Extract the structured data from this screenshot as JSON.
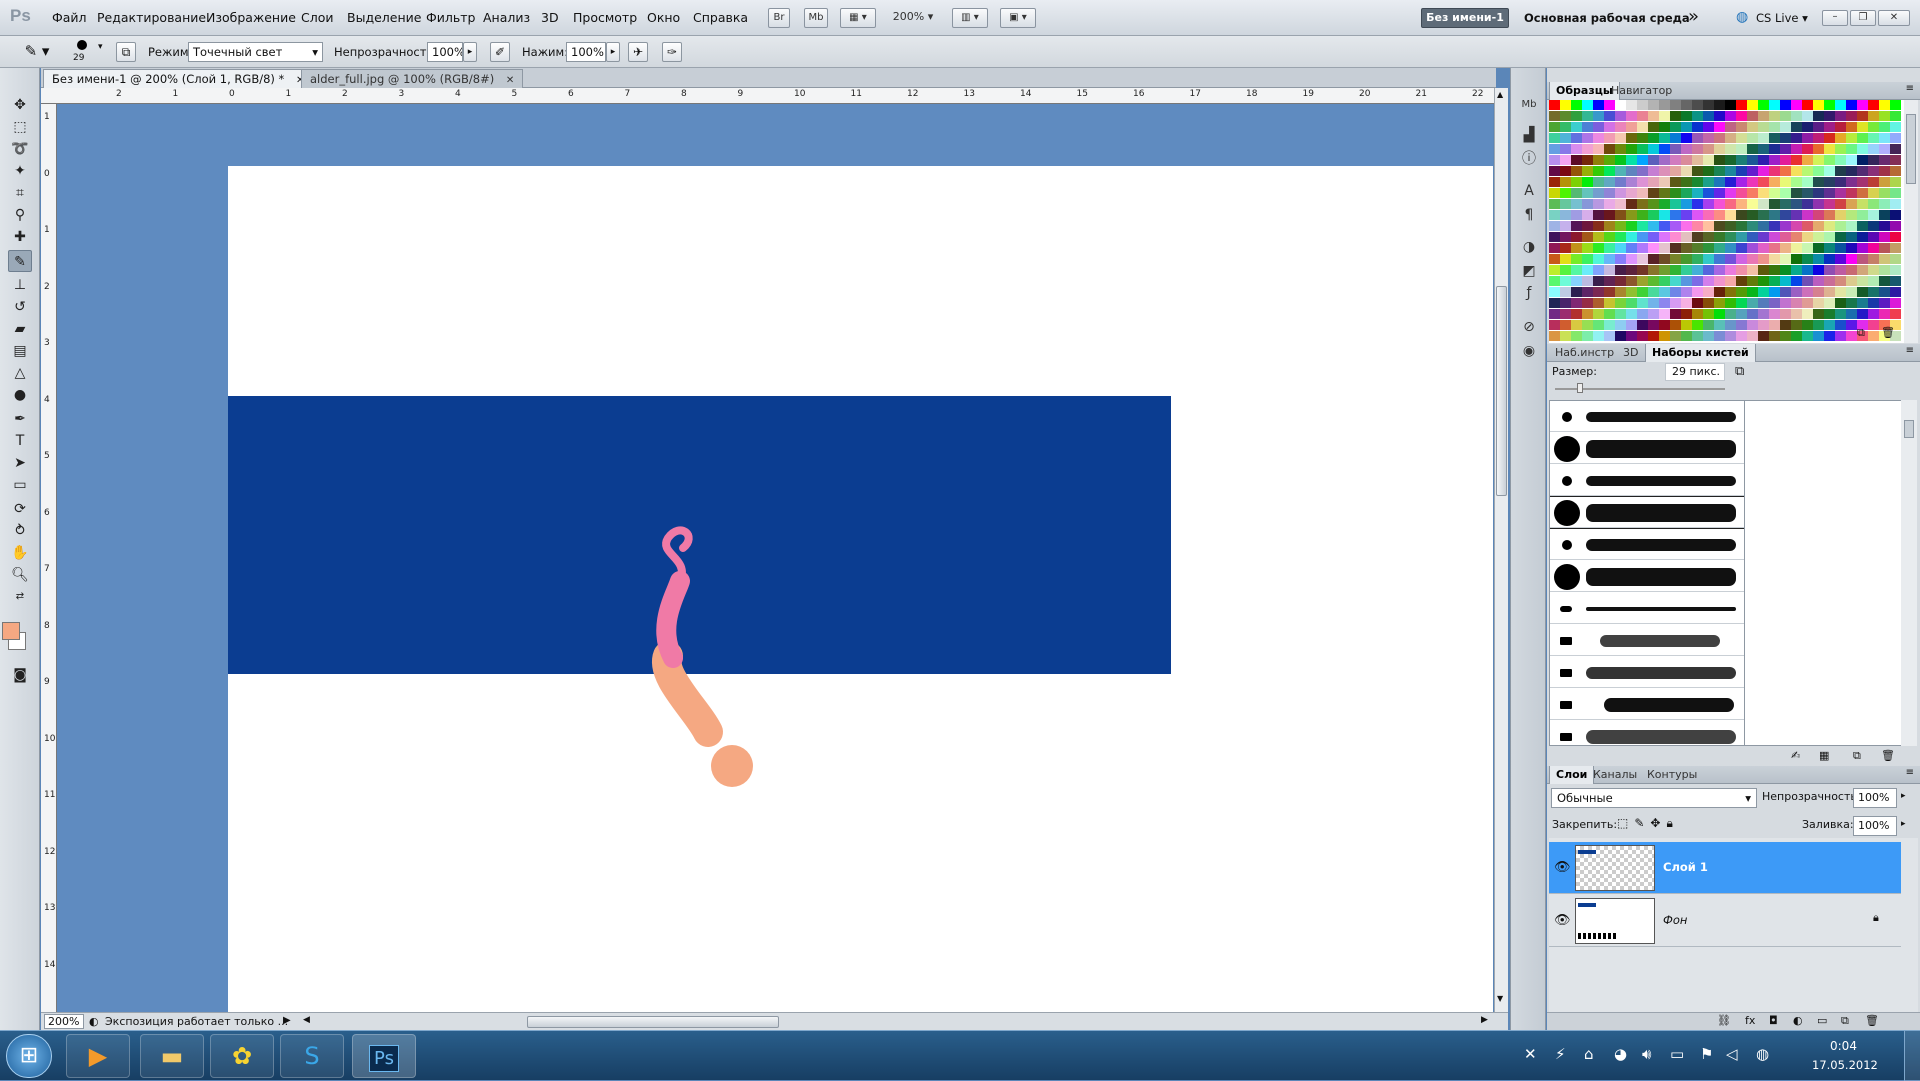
{
  "menubar": {
    "logo": "Ps",
    "items": [
      "Файл",
      "Редактирование",
      "Изображение",
      "Слои",
      "Выделение",
      "Фильтр",
      "Анализ",
      "3D",
      "Просмотр",
      "Окно",
      "Справка"
    ],
    "bridge_btn": "Br",
    "minibridge_btn": "Mb",
    "zoom": "200%",
    "doc_name_btn": "Без имени-1",
    "workspace": "Основная рабочая среда",
    "cslive": "CS Live"
  },
  "options": {
    "brush_size": "29",
    "mode_label": "Режим:",
    "mode_value": "Точечный свет",
    "opacity_label": "Непрозрачность:",
    "opacity_value": "100%",
    "flow_label": "Нажим:",
    "flow_value": "100%"
  },
  "tabs": {
    "doc1": "Без имени-1 @ 200% (Слой 1, RGB/8) *",
    "doc2": "alder_full.jpg @ 100% (RGB/8#)"
  },
  "ruler": {
    "top": [
      "2",
      "1",
      "0",
      "1",
      "2",
      "3",
      "4",
      "5",
      "6",
      "7",
      "8",
      "9",
      "10",
      "11",
      "12",
      "13",
      "14",
      "15",
      "16",
      "17",
      "18",
      "19",
      "20",
      "21",
      "22"
    ],
    "left": [
      "1",
      "0",
      "1",
      "2",
      "3",
      "4",
      "5",
      "6",
      "7",
      "8",
      "9",
      "10",
      "11",
      "12",
      "13",
      "14"
    ]
  },
  "status": {
    "zoom": "200%",
    "info": "Экспозиция работает только ..."
  },
  "swatches_panel": {
    "tabs": [
      "Образцы",
      "Навигатор"
    ]
  },
  "brushes_panel": {
    "tabs": [
      "Наб.инстр",
      "3D",
      "Наборы кистей"
    ],
    "size_label": "Размер:",
    "size_value": "29 пикс."
  },
  "layers_panel": {
    "tabs": [
      "Слои",
      "Каналы",
      "Контуры"
    ],
    "blend_mode": "Обычные",
    "opacity_label": "Непрозрачность:",
    "opacity_value": "100%",
    "lock_label": "Закрепить:",
    "fill_label": "Заливка:",
    "fill_value": "100%",
    "layers": [
      "Слой 1",
      "Фон"
    ]
  },
  "taskbar": {
    "time": "0:04",
    "date": "17.05.2012"
  },
  "colors": {
    "foreground": "#f5a882",
    "blue_rect": "#0b3d91",
    "pasteboard": "#5f8bc0",
    "layer_selected": "#3d9af7"
  }
}
